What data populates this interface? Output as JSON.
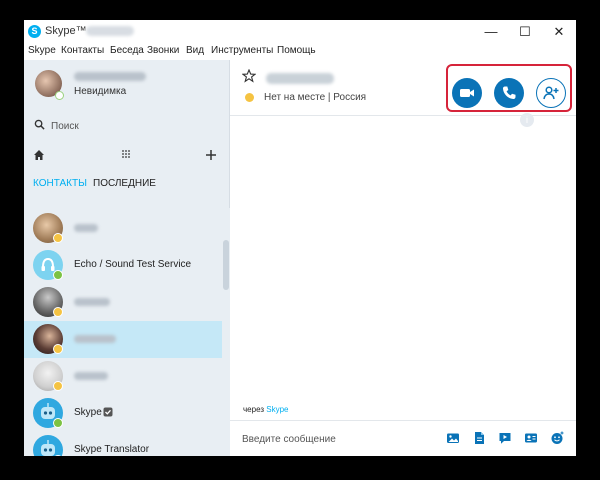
{
  "window": {
    "title": "Skype™",
    "app_logo": "S",
    "minimize_glyph": "—",
    "maximize_glyph": "☐",
    "close_glyph": "✕"
  },
  "menu": [
    "Skype",
    "Контакты",
    "Беседа",
    "Звонки",
    "Вид",
    "Инструменты",
    "Помощь"
  ],
  "profile": {
    "status": "Невидимка"
  },
  "search": {
    "placeholder": "Поиск"
  },
  "tabs": {
    "contacts": "КОНТАКТЫ",
    "recent": "ПОСЛЕДНИЕ"
  },
  "contacts": [
    {
      "name": "",
      "blurred": true,
      "status": "away",
      "avatar": "photo-1",
      "selected": false
    },
    {
      "name": "Echo / Sound Test Service",
      "blurred": false,
      "status": "online",
      "avatar": "echo-bot-icon",
      "selected": false
    },
    {
      "name": "",
      "blurred": true,
      "status": "away",
      "avatar": "photo-2",
      "selected": false
    },
    {
      "name": "",
      "blurred": true,
      "status": "away",
      "avatar": "photo-3",
      "selected": true
    },
    {
      "name": "",
      "blurred": true,
      "status": "away",
      "avatar": "photo-4",
      "selected": false
    },
    {
      "name": "Skype",
      "blurred": false,
      "status": "online",
      "avatar": "skype-bot-icon",
      "verified": true,
      "selected": false
    },
    {
      "name": "Skype Translator",
      "blurred": false,
      "status": "online",
      "avatar": "skype-bot-icon",
      "selected": false
    }
  ],
  "chat": {
    "status_text": "Нет на месте | Россия",
    "via_prefix": "через",
    "via_service": "Skype",
    "message_placeholder": "Введите сообщение",
    "hint_glyph": "i"
  },
  "colors": {
    "accent": "#00aff0",
    "call_button": "#0a73b7",
    "highlight_frame": "#d6243a",
    "online": "#7cc243",
    "away": "#f5c342",
    "selected_row": "#c5e8f7"
  }
}
